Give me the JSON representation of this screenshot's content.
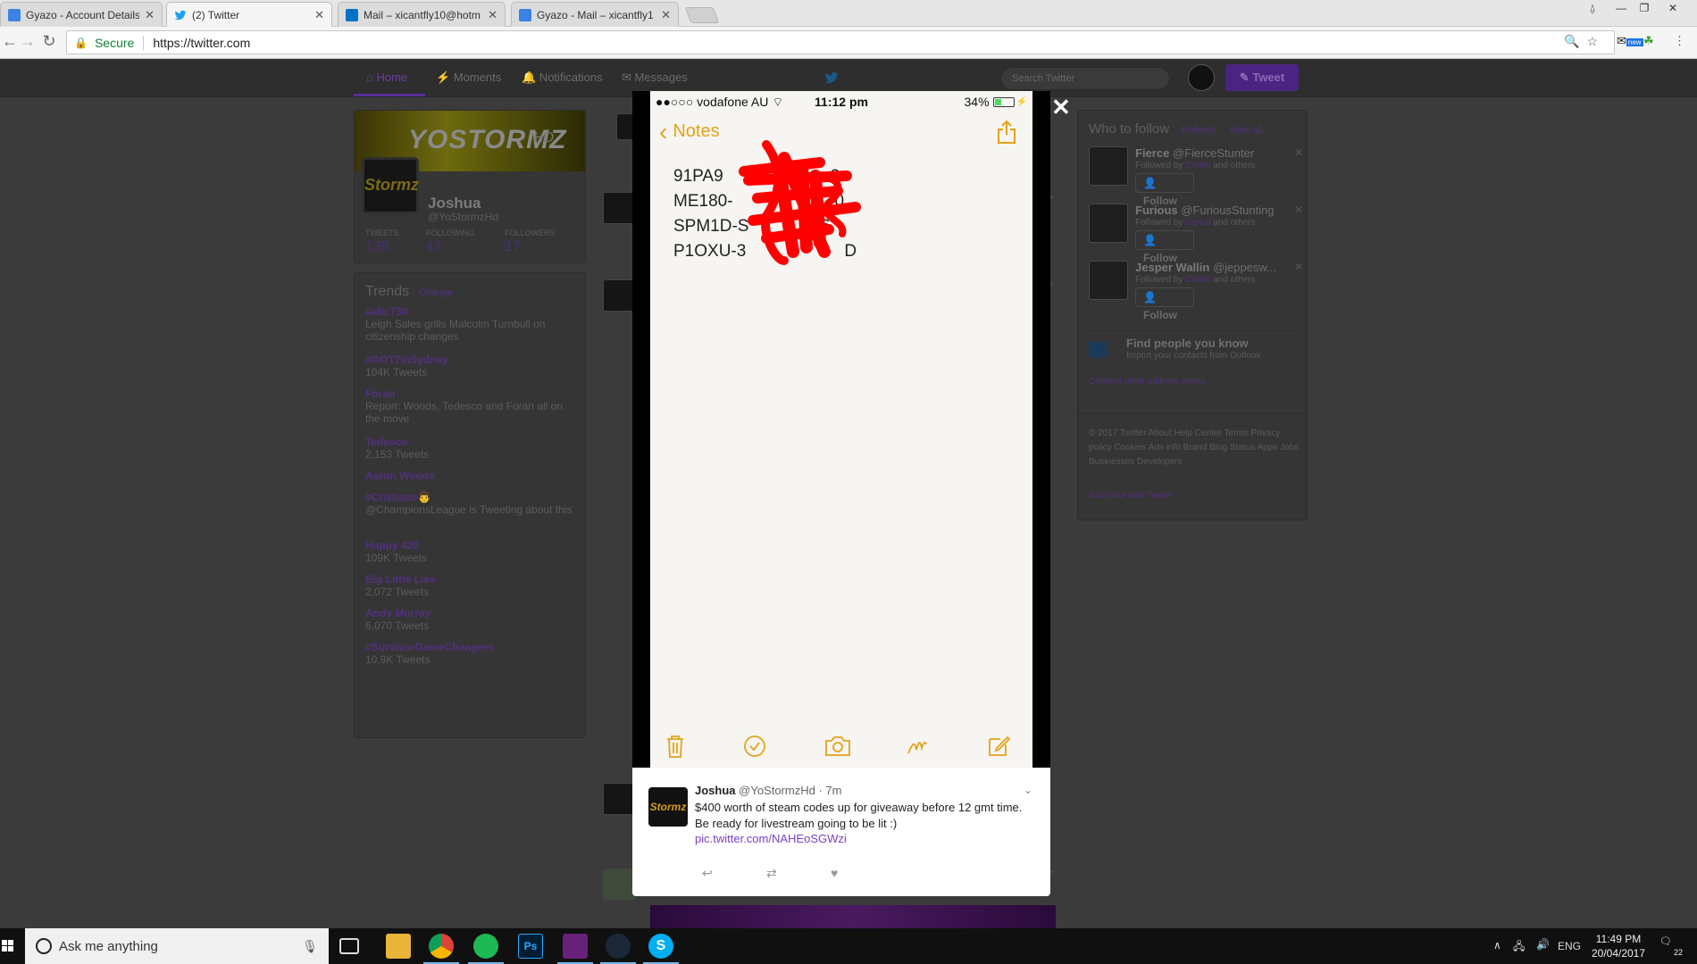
{
  "browser": {
    "tabs": [
      {
        "title": "Gyazo - Account Details",
        "icon": "gyazo-icon",
        "color": "#3b82e5"
      },
      {
        "title": "(2) Twitter",
        "icon": "twitter-icon",
        "color": "#1da1f2"
      },
      {
        "title": "Mail – xicantfly10@hotm",
        "icon": "outlook-icon",
        "color": "#0072c6"
      },
      {
        "title": "Gyazo - Mail – xicantfly1",
        "icon": "gyazo-icon",
        "color": "#3b82e5"
      }
    ],
    "secure_label": "Secure",
    "url": "https://twitter.com",
    "ext_new_badge": "new"
  },
  "twitter": {
    "nav": {
      "home": "Home",
      "moments": "Moments",
      "notifications": "Notifications",
      "messages": "Messages"
    },
    "search_placeholder": "Search Twitter",
    "tweet_button": "Tweet",
    "profile": {
      "banner_text": "YOSTORMZ",
      "banner_suffix": "HD",
      "avatar_text": "Stormz",
      "name": "Joshua",
      "handle": "@YoStormzHd",
      "stats": [
        {
          "label": "TWEETS",
          "value": "139"
        },
        {
          "label": "FOLLOWING",
          "value": "47"
        },
        {
          "label": "FOLLOWERS",
          "value": "17"
        }
      ]
    },
    "trends": {
      "title": "Trends",
      "change": "Change",
      "items": [
        {
          "tag": "#abc730",
          "desc": "Leigh Sales grills Malcolm Turnbull on citizenship changes"
        },
        {
          "tag": "#GOT7inSydney",
          "desc": "104K Tweets"
        },
        {
          "tag": "Foran",
          "desc": "Report: Woods, Tedesco and Foran all on the move"
        },
        {
          "tag": "Tedesco",
          "desc": "2,153 Tweets"
        },
        {
          "tag": "Aaron Woods",
          "desc": ""
        },
        {
          "tag": "#Cristiano👨",
          "desc": "@ChampionsLeague is Tweeting about this"
        },
        {
          "tag": "Happy 420",
          "desc": "109K Tweets"
        },
        {
          "tag": "Big Little Lies",
          "desc": "2,072 Tweets"
        },
        {
          "tag": "Andy Murray",
          "desc": "6,070 Tweets"
        },
        {
          "tag": "#SurvivorGameChangers",
          "desc": "10.9K Tweets"
        }
      ]
    },
    "who_to_follow": {
      "title": "Who to follow",
      "refresh": "Refresh",
      "view_all": "View all",
      "followed_by": "Followed by",
      "followed_name": "Consti",
      "and_others": "and others",
      "follow_label": "Follow",
      "people": [
        {
          "name": "Fierce",
          "handle": "@FierceStunter"
        },
        {
          "name": "Furious",
          "handle": "@FuriousStunting"
        },
        {
          "name": "Jesper Wallin",
          "handle": "@jeppesw..."
        }
      ],
      "find_people_title": "Find people you know",
      "find_people_sub": "Import your contacts from Outlook",
      "connect_link": "Connect other address books"
    },
    "footer": {
      "links": "© 2017 Twitter  About  Help Center  Terms  Privacy policy  Cookies  Ads info  Brand  Blog  Status  Apps  Jobs  Businesses  Developers",
      "advertise": "Advertise with Twitter"
    }
  },
  "phone": {
    "carrier": "●●○○○ vodafone AU",
    "time": "11:12 pm",
    "battery": "34%",
    "battery_level": 0.34,
    "back_label": "Notes",
    "note_lines": [
      "91PA9",
      "ME180-",
      "SPM1D-S",
      "P1OXU-3"
    ],
    "note_line_ends": [
      "2",
      "0",
      "36",
      "D"
    ],
    "accent_color": "#e3a21a",
    "redaction_color": "#ff0000"
  },
  "modal_tweet": {
    "name": "Joshua",
    "handle": "@YoStormzHd",
    "time": "· 7m",
    "text": "$400 worth of steam codes up for giveaway before 12 gmt time. Be ready for livestream going to be lit :)",
    "link": "pic.twitter.com/NAHEoSGWzi",
    "avatar_text": "Stormz"
  },
  "taskbar": {
    "search_placeholder": "Ask me anything",
    "apps": [
      "task-view-icon",
      "file-explorer-icon",
      "chrome-icon",
      "spotify-icon",
      "photoshop-icon",
      "visual-studio-icon",
      "steam-icon",
      "skype-icon"
    ],
    "language": "ENG",
    "time": "11:49 PM",
    "date": "20/04/2017",
    "notification_count": "22"
  }
}
